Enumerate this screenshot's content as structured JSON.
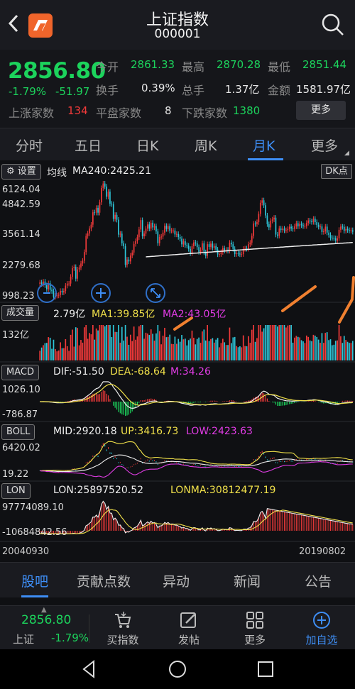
{
  "header": {
    "title": "上证指数",
    "code": "000001"
  },
  "quote": {
    "price": "2856.80",
    "change_pct": "-1.79%",
    "change": "-51.97",
    "open_label": "今开",
    "open": "2861.33",
    "high_label": "最高",
    "high": "2870.28",
    "low_label": "最低",
    "low": "2851.44",
    "turnover_label": "换手",
    "turnover": "0.39%",
    "volume_label": "总手",
    "volume": "1.37亿",
    "amount_label": "金额",
    "amount": "1581.97亿",
    "up_label": "上涨家数",
    "up": "134",
    "flat_label": "平盘家数",
    "flat": "8",
    "down_label": "下跌家数",
    "down": "1380",
    "more": "更多"
  },
  "tabs": [
    "分时",
    "五日",
    "日K",
    "周K",
    "月K",
    "更多"
  ],
  "chart": {
    "settings": "设置",
    "ma_label": "均线",
    "ma240": "MA240:2425.21",
    "dk": "DK点",
    "price_axis": [
      "6124.04",
      "4842.59",
      "3561.14",
      "2279.68",
      "998.23"
    ],
    "volume_btn": "成交量",
    "volume_val": "2.79亿",
    "vol_ma1": "MA1:39.85亿",
    "vol_ma2": "MA2:43.05亿",
    "volume_axis": "132亿",
    "macd_btn": "MACD",
    "macd_dif": "DIF:-51.50",
    "macd_dea": "DEA:-68.64",
    "macd_m": "M:34.26",
    "macd_axis": [
      "1026.10",
      "-786.87"
    ],
    "boll_btn": "BOLL",
    "boll_mid": "MID:2920.18",
    "boll_up": "UP:3416.73",
    "boll_low": "LOW:2423.63",
    "boll_axis": [
      "6420.02",
      "19.22"
    ],
    "lon_btn": "LON",
    "lon_val": "LON:25897520.52",
    "lonma": "LONMA:30812477.19",
    "lon_axis": [
      "97774089.10",
      "-10684842.56"
    ],
    "start_date": "20040930",
    "end_date": "20190802"
  },
  "bottom_tabs": [
    "股吧",
    "贡献点数",
    "异动",
    "新闻",
    "公告"
  ],
  "action_bar": {
    "price": "2856.80",
    "name": "上证",
    "change": "-1.79%",
    "buy_index": "买指数",
    "post": "发帖",
    "more": "更多",
    "add_watch": "加自选"
  },
  "colors": {
    "up": "#f23a3a",
    "down": "#1cd35c",
    "accent": "#3e8ef5",
    "candle_down": "#2ec6d9"
  },
  "chart_data": {
    "type": "candlestick",
    "title": "上证指数 月K",
    "x_range": [
      "20040930",
      "20190802"
    ],
    "price_ylim": [
      998.23,
      6124.04
    ],
    "monthly_close": [
      1321,
      1290,
      1340,
      1266,
      1191,
      1306,
      1181,
      1159,
      1060,
      1080,
      1083,
      1092,
      1162,
      1135,
      1161,
      1258,
      1299,
      1299,
      1440,
      1641,
      1672,
      1399,
      1612,
      1658,
      1763,
      1837,
      2099,
      2675,
      2786,
      2998,
      3183,
      3841,
      3821,
      4109,
      3820,
      4471,
      5552,
      5954,
      5688,
      4871,
      5261,
      4383,
      4348,
      3472,
      3693,
      3433,
      2736,
      2775,
      2397,
      2293,
      1728,
      1871,
      1820,
      1990,
      2082,
      2373,
      2477,
      2632,
      2959,
      3412,
      2667,
      2779,
      2996,
      3195,
      2996,
      3277,
      3051,
      3109,
      2870,
      2398,
      2638,
      2655,
      2820,
      3127,
      2979,
      3114,
      2905,
      2911,
      2911,
      2743,
      2762,
      2638,
      2567,
      2359,
      2470,
      2333,
      2313,
      2199,
      2058,
      2292,
      2428,
      2395,
      2262,
      2103,
      2169,
      2396,
      2092,
      1981,
      2365,
      2269,
      2385,
      2236,
      2300,
      2178,
      2026,
      2033,
      2098,
      2220,
      2141,
      2175,
      2139,
      2420,
      2363,
      2201,
      2033,
      2056,
      2048,
      2026,
      2033,
      2201,
      2217,
      2204,
      2363,
      2420,
      2682,
      3234,
      3210,
      3310,
      3748,
      4441,
      4611,
      4277,
      3663,
      3206,
      3053,
      3382,
      3445,
      3539,
      2738,
      2688,
      3004,
      2938,
      2997,
      2916,
      2929,
      2979,
      3085,
      3004,
      2979,
      3100,
      3250,
      3102,
      3222,
      3154,
      3110,
      3117,
      3273,
      3393,
      3348,
      3317,
      3480,
      3311,
      3168,
      3082,
      3095,
      2847,
      2876,
      3090,
      2821,
      2725,
      2606,
      2602,
      2588,
      2494,
      2584,
      2941,
      3090,
      3078,
      2898,
      2979,
      2932,
      2905,
      2929,
      2857
    ],
    "ma240": 2425.21,
    "volume_unit": "亿",
    "volume_max": 132,
    "indicators": {
      "MACD": {
        "DIF": -51.5,
        "DEA": -68.64,
        "M": 34.26,
        "ylim": [
          -786.87,
          1026.1
        ]
      },
      "BOLL": {
        "MID": 2920.18,
        "UP": 3416.73,
        "LOW": 2423.63,
        "ylim": [
          19.22,
          6420.02
        ]
      },
      "LON": {
        "LON": 25897520.52,
        "LONMA": 30812477.19,
        "ylim": [
          -10684842.56,
          97774089.1
        ]
      }
    }
  }
}
